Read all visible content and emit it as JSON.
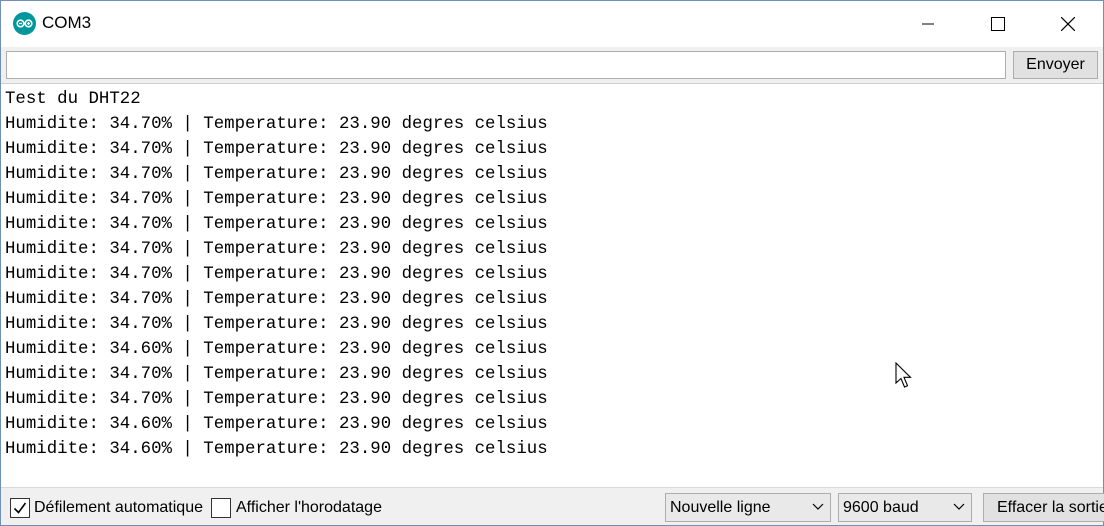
{
  "window": {
    "title": "COM3",
    "app_icon": "arduino-icon"
  },
  "send": {
    "input_value": "",
    "button_label": "Envoyer"
  },
  "output": {
    "lines": [
      "Test du DHT22",
      "Humidite: 34.70% | Temperature: 23.90 degres celsius",
      "Humidite: 34.70% | Temperature: 23.90 degres celsius",
      "Humidite: 34.70% | Temperature: 23.90 degres celsius",
      "Humidite: 34.70% | Temperature: 23.90 degres celsius",
      "Humidite: 34.70% | Temperature: 23.90 degres celsius",
      "Humidite: 34.70% | Temperature: 23.90 degres celsius",
      "Humidite: 34.70% | Temperature: 23.90 degres celsius",
      "Humidite: 34.70% | Temperature: 23.90 degres celsius",
      "Humidite: 34.70% | Temperature: 23.90 degres celsius",
      "Humidite: 34.60% | Temperature: 23.90 degres celsius",
      "Humidite: 34.70% | Temperature: 23.90 degres celsius",
      "Humidite: 34.70% | Temperature: 23.90 degres celsius",
      "Humidite: 34.60% | Temperature: 23.90 degres celsius",
      "Humidite: 34.60% | Temperature: 23.90 degres celsius"
    ]
  },
  "bottom": {
    "autoscroll": {
      "label": "Défilement automatique",
      "checked": true
    },
    "timestamp": {
      "label": "Afficher l'horodatage",
      "checked": false
    },
    "line_ending": "Nouvelle ligne",
    "baud_rate": "9600 baud",
    "clear_label": "Effacer la sortie"
  },
  "colors": {
    "accent": "#00979c",
    "panel": "#f0f0f0"
  }
}
